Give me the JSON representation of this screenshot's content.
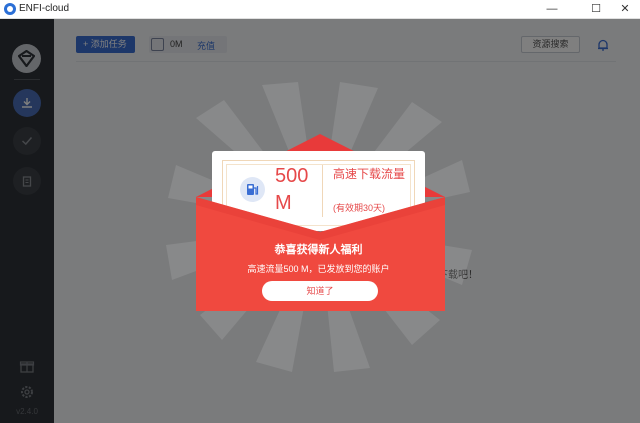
{
  "window": {
    "title": "ENFI-cloud",
    "minimize": "—",
    "maximize": "☐",
    "close": "✕"
  },
  "sidebar": {
    "version": "v2.4.0"
  },
  "header": {
    "add_task_label": "+ 添加任务",
    "flow_amount": "0M",
    "recharge_label": "充值",
    "resource_search_label": "资源搜索"
  },
  "main": {
    "empty_message": "下载吧！"
  },
  "modal": {
    "card_amount": "500 M",
    "card_title": "高速下载流量",
    "card_validity": "(有效期30天)",
    "title": "恭喜获得新人福利",
    "subtitle": "高速流量500 M，已发放到您的账户",
    "confirm_label": "知道了"
  },
  "colors": {
    "sidebar_bg": "#2e3238",
    "accent_blue": "#3a6ed3",
    "envelope_red": "#f0493f",
    "envelope_flap": "#e83a3a",
    "text_red": "#e6494a"
  },
  "icons": {
    "logo": "enfi-logo-icon",
    "download": "download-icon",
    "completed": "check-icon",
    "trash": "trash-icon",
    "gift": "gift-icon",
    "settings": "gear-icon",
    "bell": "bell-icon",
    "flow": "flow-icon",
    "gauge": "gauge-icon"
  }
}
